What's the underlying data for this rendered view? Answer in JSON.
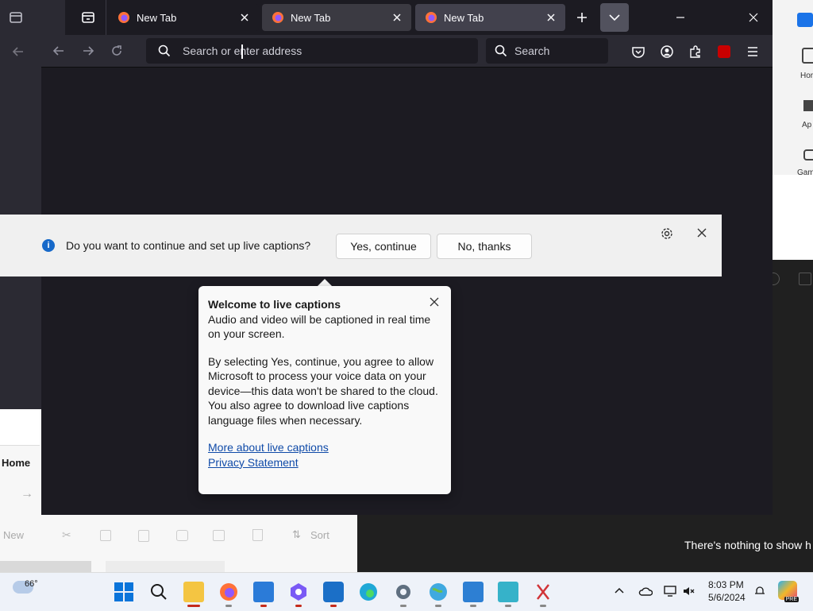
{
  "browser": {
    "tabs": [
      {
        "label": "New Tab",
        "active": false
      },
      {
        "label": "New Tab",
        "active": false
      },
      {
        "label": "New Tab",
        "active": true
      }
    ],
    "url_placeholder": "Search or enter address",
    "search_placeholder": "Search"
  },
  "captions_banner": {
    "question": "Do you want to continue and set up live captions?",
    "yes_label": "Yes, continue",
    "no_label": "No, thanks"
  },
  "popup": {
    "title": "Welcome to live captions",
    "intro": "Audio and video will be captioned in real time on your screen.",
    "body": "By selecting Yes, continue, you agree to allow Microsoft to process your voice data on your device—this data won't be shared to the cloud. You also agree to download live captions language files when necessary.",
    "link_more": "More about live captions",
    "link_privacy": "Privacy Statement"
  },
  "background": {
    "right_app_labels": [
      "Hor",
      "Ap",
      "Gam"
    ],
    "explorer": {
      "home": "Home",
      "new_label": "New",
      "sort_label": "Sort"
    },
    "nothing_text": "There's nothing to show h"
  },
  "taskbar": {
    "weather_temp": "66°",
    "time": "8:03 PM",
    "date": "5/6/2024",
    "pre_badge": "PRE"
  },
  "colors": {
    "firefox_bg": "#1c1b22",
    "firefox_toolbar": "#2b2a33",
    "banner_bg": "#f0f0f0",
    "link": "#0f4aa8",
    "info_blue": "#1769c9",
    "taskbar_bg": "#eef2f9"
  }
}
